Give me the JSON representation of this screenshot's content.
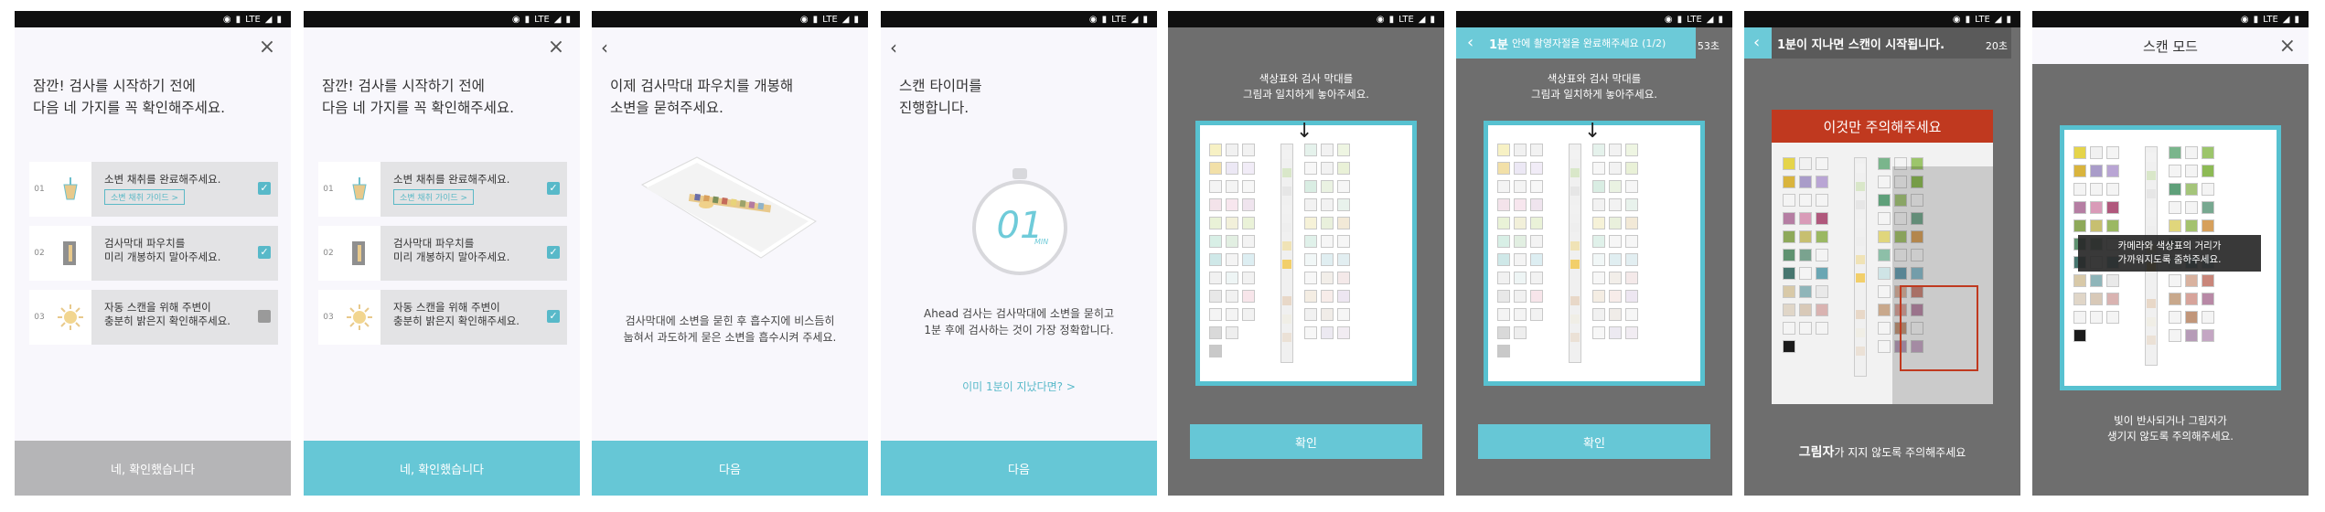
{
  "status_bar": {
    "icons": [
      "eye-icon",
      "vibrate-icon",
      "lte-icon",
      "wifi-icon",
      "battery-icon"
    ],
    "network": "LTE"
  },
  "colors": {
    "teal": "#66c7d6",
    "teal_dark": "#57c1d0",
    "gray_button": "#b5b5b7",
    "warn_red": "#c0391f",
    "screen_dark": "#6e6e6e"
  },
  "screens": [
    {
      "title": "잠깐! 검사를 시작하기 전에\n다음 네 가지를 꼭 확인해주세요.",
      "items": [
        {
          "num": "01",
          "text": "소변 채취를 완료해주세요.",
          "link": "소변 채취 가이드 >",
          "checked": true,
          "icon": "cup-icon"
        },
        {
          "num": "02",
          "text": "검사막대 파우치를\n미리 개봉하지 말아주세요.",
          "checked": true,
          "icon": "pouch-icon"
        },
        {
          "num": "03",
          "text": "자동 스캔을 위해 주변이\n충분히 밝은지 확인해주세요.",
          "checked": false,
          "icon": "light-icon"
        }
      ],
      "button": "네, 확인했습니다"
    },
    {
      "title": "잠깐! 검사를 시작하기 전에\n다음 네 가지를 꼭 확인해주세요.",
      "items": [
        {
          "num": "01",
          "text": "소변 채취를 완료해주세요.",
          "link": "소변 채취 가이드 >",
          "checked": true,
          "icon": "cup-icon"
        },
        {
          "num": "02",
          "text": "검사막대 파우치를\n미리 개봉하지 말아주세요.",
          "checked": true,
          "icon": "pouch-icon"
        },
        {
          "num": "03",
          "text": "자동 스캔을 위해 주변이\n충분히 밝은지 확인해주세요.",
          "checked": true,
          "icon": "light-icon"
        }
      ],
      "button": "네, 확인했습니다"
    },
    {
      "title": "이제 검사막대 파우치를 개봉해\n소변을 묻혀주세요.",
      "desc": "검사막대에 소변을 묻힌 후 흡수지에 비스듬히\n눕혀서 과도하게 묻은 소변을 흡수시켜 주세요.",
      "button": "다음"
    },
    {
      "title": "스캔 타이머를\n진행합니다.",
      "timer": "01",
      "timer_unit": "MIN",
      "desc": "Ahead 검사는 검사막대에 소변을 묻히고\n1분 후에 검사하는 것이 가장 정확합니다.",
      "link": "이미 1분이 지났다면? >",
      "button": "다음"
    },
    {
      "guide": "색상표와 검사 막대를\n그림과 일치하게 놓아주세요.",
      "button": "확인"
    },
    {
      "banner_bold": "1분",
      "banner_text": "안에 촬영자절을 완료해주세요 (1/2)",
      "banner_time": "53초",
      "guide": "색상표와 검사 막대를\n그림과 일치하게 놓아주세요.",
      "button": "확인"
    },
    {
      "banner_bold": "1분이 지나면 스캔이 시작됩니다.",
      "banner_time": "20초",
      "warn": "이것만 주의해주세요",
      "caution_bold": "그림자",
      "caution_rest": "가 지지 않도록 주의해주세요"
    },
    {
      "header": "스캔 모드",
      "tooltip": "카메라와 색상표의 거리가\n가까워지도록 줌하주세요.",
      "caption": "빛이 반사되거나 그림자가\n생기지 않도록 주의해주세요."
    }
  ]
}
